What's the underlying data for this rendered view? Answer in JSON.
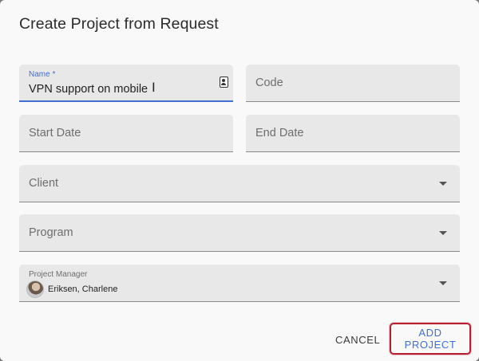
{
  "dialog": {
    "title": "Create Project from Request",
    "name_field": {
      "label": "Name *",
      "value": "VPN support on mobile"
    },
    "code_field": {
      "placeholder": "Code"
    },
    "start_date_field": {
      "placeholder": "Start Date"
    },
    "end_date_field": {
      "placeholder": "End Date"
    },
    "client_field": {
      "placeholder": "Client"
    },
    "program_field": {
      "placeholder": "Program"
    },
    "project_manager_field": {
      "label": "Project Manager",
      "value": "Eriksen, Charlene"
    },
    "buttons": {
      "cancel": "CANCEL",
      "add_project": "ADD PROJECT"
    }
  },
  "icons": {
    "name_field_icon": "contact-card-icon",
    "dropdown_icon": "caret-down-icon",
    "text_cursor": "i-beam-cursor-icon"
  },
  "colors": {
    "accent": "#3f6fd1",
    "highlight_border": "#b8202f",
    "field_bg": "#e8e8e8"
  }
}
